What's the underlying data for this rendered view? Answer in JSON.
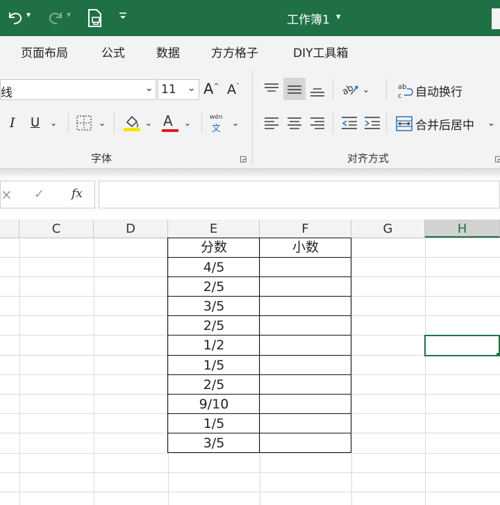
{
  "title_bar": {
    "undo_icon": "undo-icon",
    "redo_icon": "redo-icon",
    "print_preview_icon": "print-preview-icon",
    "customize_icon": "customize-icon",
    "workbook_title": "工作簿1",
    "title_chevron": "▾",
    "bg_color": "#1f7145"
  },
  "tabs": [
    {
      "label": "页面布局"
    },
    {
      "label": "公式"
    },
    {
      "label": "数据"
    },
    {
      "label": "方方格子"
    },
    {
      "label": "DIY工具箱"
    }
  ],
  "ribbon": {
    "font_name": "线",
    "font_size": "11",
    "grow_font": "A",
    "shrink_font": "A",
    "italic": "I",
    "underline": "U",
    "font_color_letter": "A",
    "phonetic_top": "wén",
    "phonetic_bottom": "文",
    "wrap_text": "自动换行",
    "merge_center": "合并后居中",
    "group_font": "字体",
    "group_alignment": "对齐方式"
  },
  "formula_bar": {
    "cancel": "×",
    "enter": "✓",
    "fx": "fx",
    "value": ""
  },
  "columns": [
    "C",
    "D",
    "E",
    "F",
    "G",
    "H"
  ],
  "selected_column": "H",
  "table": {
    "header_e": "分数",
    "header_f": "小数",
    "fractions": [
      "4/5",
      "2/5",
      "3/5",
      "2/5",
      "1/2",
      "1/5",
      "2/5",
      "9/10",
      "1/5",
      "3/5"
    ]
  }
}
